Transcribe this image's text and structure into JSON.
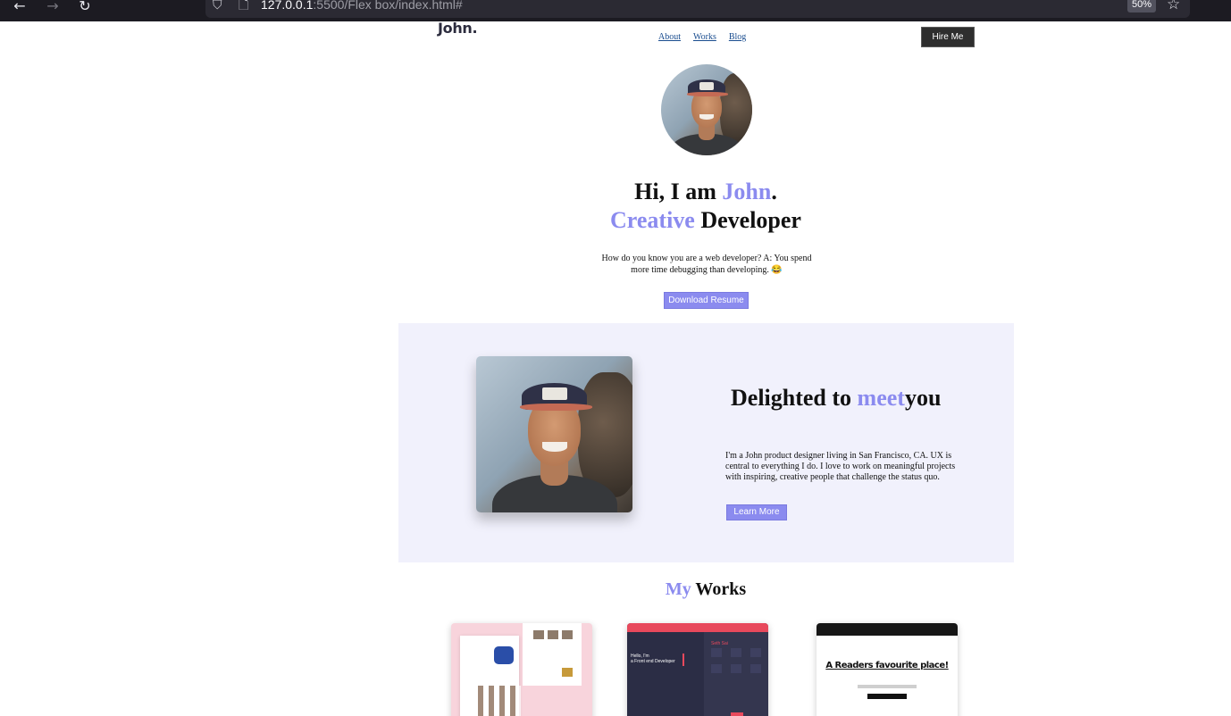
{
  "browser": {
    "url_host": "127.0.0.1",
    "url_path": ":5500/Flex box/index.html#",
    "zoom": "50%"
  },
  "header": {
    "logo": "John.",
    "menu": [
      "About",
      "Works",
      "Blog"
    ],
    "hire_label": "Hire Me"
  },
  "hero": {
    "line1_pre": "Hi, I am ",
    "line1_accent": "John",
    "line1_post": ".",
    "line2_accent": "Creative",
    "line2_post": " Developer",
    "subtitle": "How do you know you are a web developer? A: You spend more time debugging than developing. 😂",
    "download_label": "Download Resume"
  },
  "about": {
    "title_pre": "Delighted to ",
    "title_accent": "meet",
    "title_post": "you",
    "text": "I'm a John product designer living in San Francisco, CA. UX is central to everything I do. I love to work on meaningful projects with inspiring, creative people that challenge the status quo.",
    "learn_label": "Learn More"
  },
  "works": {
    "title_accent": "My",
    "title_post": " Works",
    "cards": [
      {
        "name": "furniture-shop"
      },
      {
        "name": "portfolio-dark",
        "text": "Hello, I'm\na Front end Developer",
        "side_title": "Seth Sai"
      },
      {
        "name": "readers-place",
        "title": "A Readers favourite place!"
      }
    ]
  },
  "colors": {
    "accent": "#8b8bef",
    "about_bg": "#f1f1fc",
    "hire_bg": "#2e2e2e"
  }
}
